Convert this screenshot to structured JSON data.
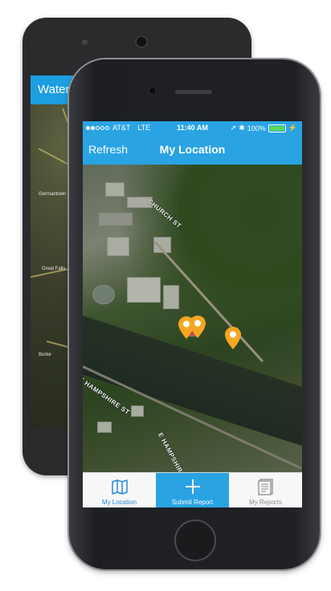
{
  "android_app": {
    "title_partial": "Water"
  },
  "android_map_labels": [
    "Germantown",
    "Great Falls",
    "Burke"
  ],
  "status_bar": {
    "carrier": "AT&T",
    "network": "LTE",
    "time": "11:40 AM",
    "battery": "100%"
  },
  "nav_bar": {
    "left_button": "Refresh",
    "title": "My Location"
  },
  "map": {
    "streets": [
      "CHURCH ST",
      "E HAMPSHIRE ST",
      "E HAMPSHIRE ST"
    ],
    "pins": [
      {
        "color": "#f5a623"
      },
      {
        "color": "#f5a623"
      },
      {
        "color": "#f5a623"
      }
    ]
  },
  "tab_bar": {
    "tabs": [
      {
        "label": "My Location",
        "icon": "map-icon",
        "active": false
      },
      {
        "label": "Submit Report",
        "icon": "plus-icon",
        "active": true
      },
      {
        "label": "My Reports",
        "icon": "reports-icon",
        "active": false
      }
    ]
  },
  "colors": {
    "accent": "#2aa3e3",
    "pin": "#f5a623",
    "tab_active_text": "#2a8ad9"
  }
}
